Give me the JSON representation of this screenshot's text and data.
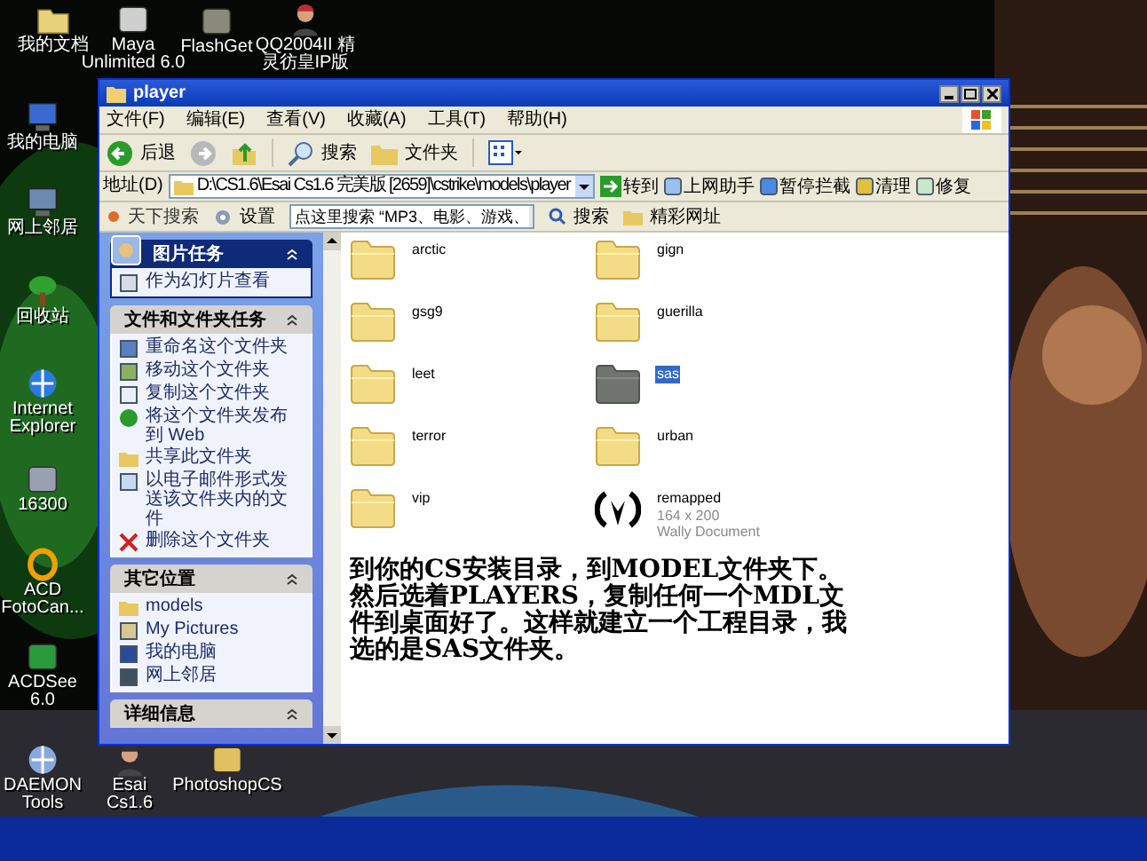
{
  "desktop_icons": [
    {
      "label": "我的文档"
    },
    {
      "label": "Maya Unlimited 6.0"
    },
    {
      "label": "FlashGet"
    },
    {
      "label": "QQ2004II 精灵彷皇IP版"
    },
    {
      "label": "我的电脑"
    },
    {
      "label": "网上邻居"
    },
    {
      "label": "回收站"
    },
    {
      "label": "Internet Explorer"
    },
    {
      "label": "16300"
    },
    {
      "label": "ACD FotoCan..."
    },
    {
      "label": "ACDSee 6.0"
    },
    {
      "label": "DAEMON Tools"
    },
    {
      "label": "Esai Cs1.6"
    },
    {
      "label": "PhotoshopCS"
    }
  ],
  "window": {
    "title": "player"
  },
  "menu": [
    "文件(F)",
    "编辑(E)",
    "查看(V)",
    "收藏(A)",
    "工具(T)",
    "帮助(H)"
  ],
  "toolbar": {
    "back": "后退",
    "search": "搜索",
    "folders": "文件夹"
  },
  "address_bar": {
    "label": "地址(D)",
    "value": "D:\\CS1.6\\Esai Cs1.6 完美版 [2659]\\cstrike\\models\\player",
    "go": "转到",
    "extras": [
      "上网助手",
      "暂停拦截",
      "清理",
      "修复"
    ]
  },
  "search_toolbar": {
    "brand": "天下搜索",
    "settings": "设置",
    "search_value": "点这里搜索 “MP3、电影、游戏、",
    "search_button": "搜索",
    "links": "精彩网址"
  },
  "task_pane": [
    {
      "kind": "special",
      "title": "图片任务",
      "items": [
        "作为幻灯片查看"
      ]
    },
    {
      "kind": "normal",
      "title": "文件和文件夹任务",
      "items": [
        "重命名这个文件夹",
        "移动这个文件夹",
        "复制这个文件夹",
        "将这个文件夹发布到 Web",
        "共享此文件夹",
        "以电子邮件形式发送该文件夹内的文件",
        "删除这个文件夹"
      ]
    },
    {
      "kind": "normal",
      "title": "其它位置",
      "items": [
        "models",
        "My Pictures",
        "我的电脑",
        "网上邻居"
      ]
    },
    {
      "kind": "normal",
      "title": "详细信息"
    }
  ],
  "files": [
    {
      "kind": "folder",
      "name": "arctic",
      "selected": false
    },
    {
      "kind": "folder",
      "name": "gign",
      "selected": false
    },
    {
      "kind": "folder",
      "name": "gsg9",
      "selected": false
    },
    {
      "kind": "folder",
      "name": "guerilla",
      "selected": false
    },
    {
      "kind": "folder",
      "name": "leet",
      "selected": false
    },
    {
      "kind": "folder",
      "name": "sas",
      "selected": true
    },
    {
      "kind": "folder",
      "name": "terror",
      "selected": false
    },
    {
      "kind": "folder",
      "name": "urban",
      "selected": false
    },
    {
      "kind": "folder",
      "name": "vip",
      "selected": false
    },
    {
      "kind": "document",
      "name": "remapped",
      "details": [
        "164 x 200",
        "Wally Document"
      ],
      "selected": false
    }
  ],
  "note": "到你的CS安装目录，到MODEL文件夹下。然后选着PLAYERS，复制任何一个MDL文件到桌面好了。这样就建立一个工程目录，我选的是SAS文件夹。"
}
